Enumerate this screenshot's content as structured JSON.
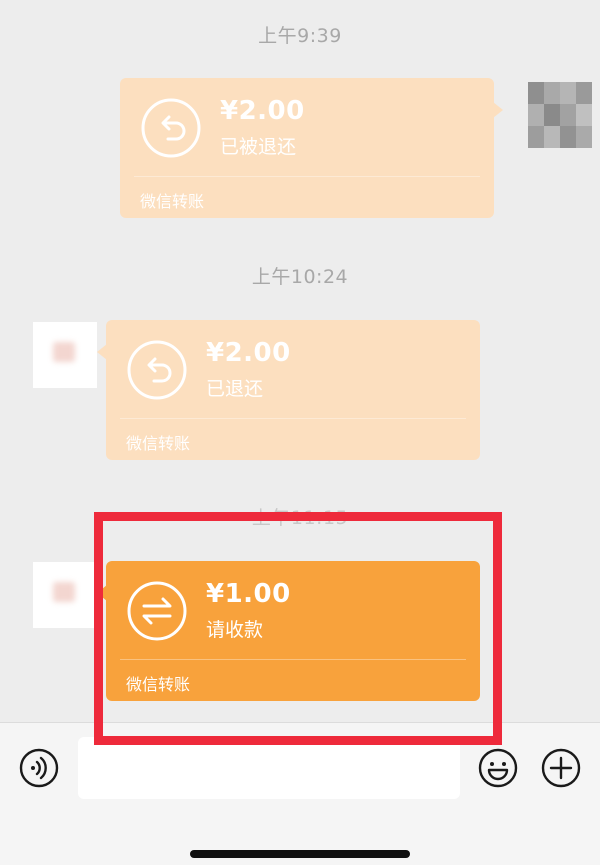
{
  "chat": {
    "timestamps": [
      "上午9:39",
      "上午10:24",
      "上午11:15"
    ],
    "messages": [
      {
        "sender": "self",
        "amount": "¥2.00",
        "status": "已被退还",
        "brand": "微信转账",
        "icon": "refund-arrow-icon"
      },
      {
        "sender": "other",
        "amount": "¥2.00",
        "status": "已退还",
        "brand": "微信转账",
        "icon": "refund-arrow-icon"
      },
      {
        "sender": "other",
        "amount": "¥1.00",
        "status": "请收款",
        "brand": "微信转账",
        "icon": "transfer-arrows-icon"
      }
    ]
  },
  "input_bar": {
    "icons": [
      "voice-icon",
      "emoji-icon",
      "plus-icon"
    ],
    "text_value": ""
  },
  "colors": {
    "card_pending": "#f8a23c",
    "card_done": "#fcdfbf",
    "highlight_border": "#ee2a3b",
    "timestamp_text": "#a8a8a8",
    "background": "#ededed"
  }
}
